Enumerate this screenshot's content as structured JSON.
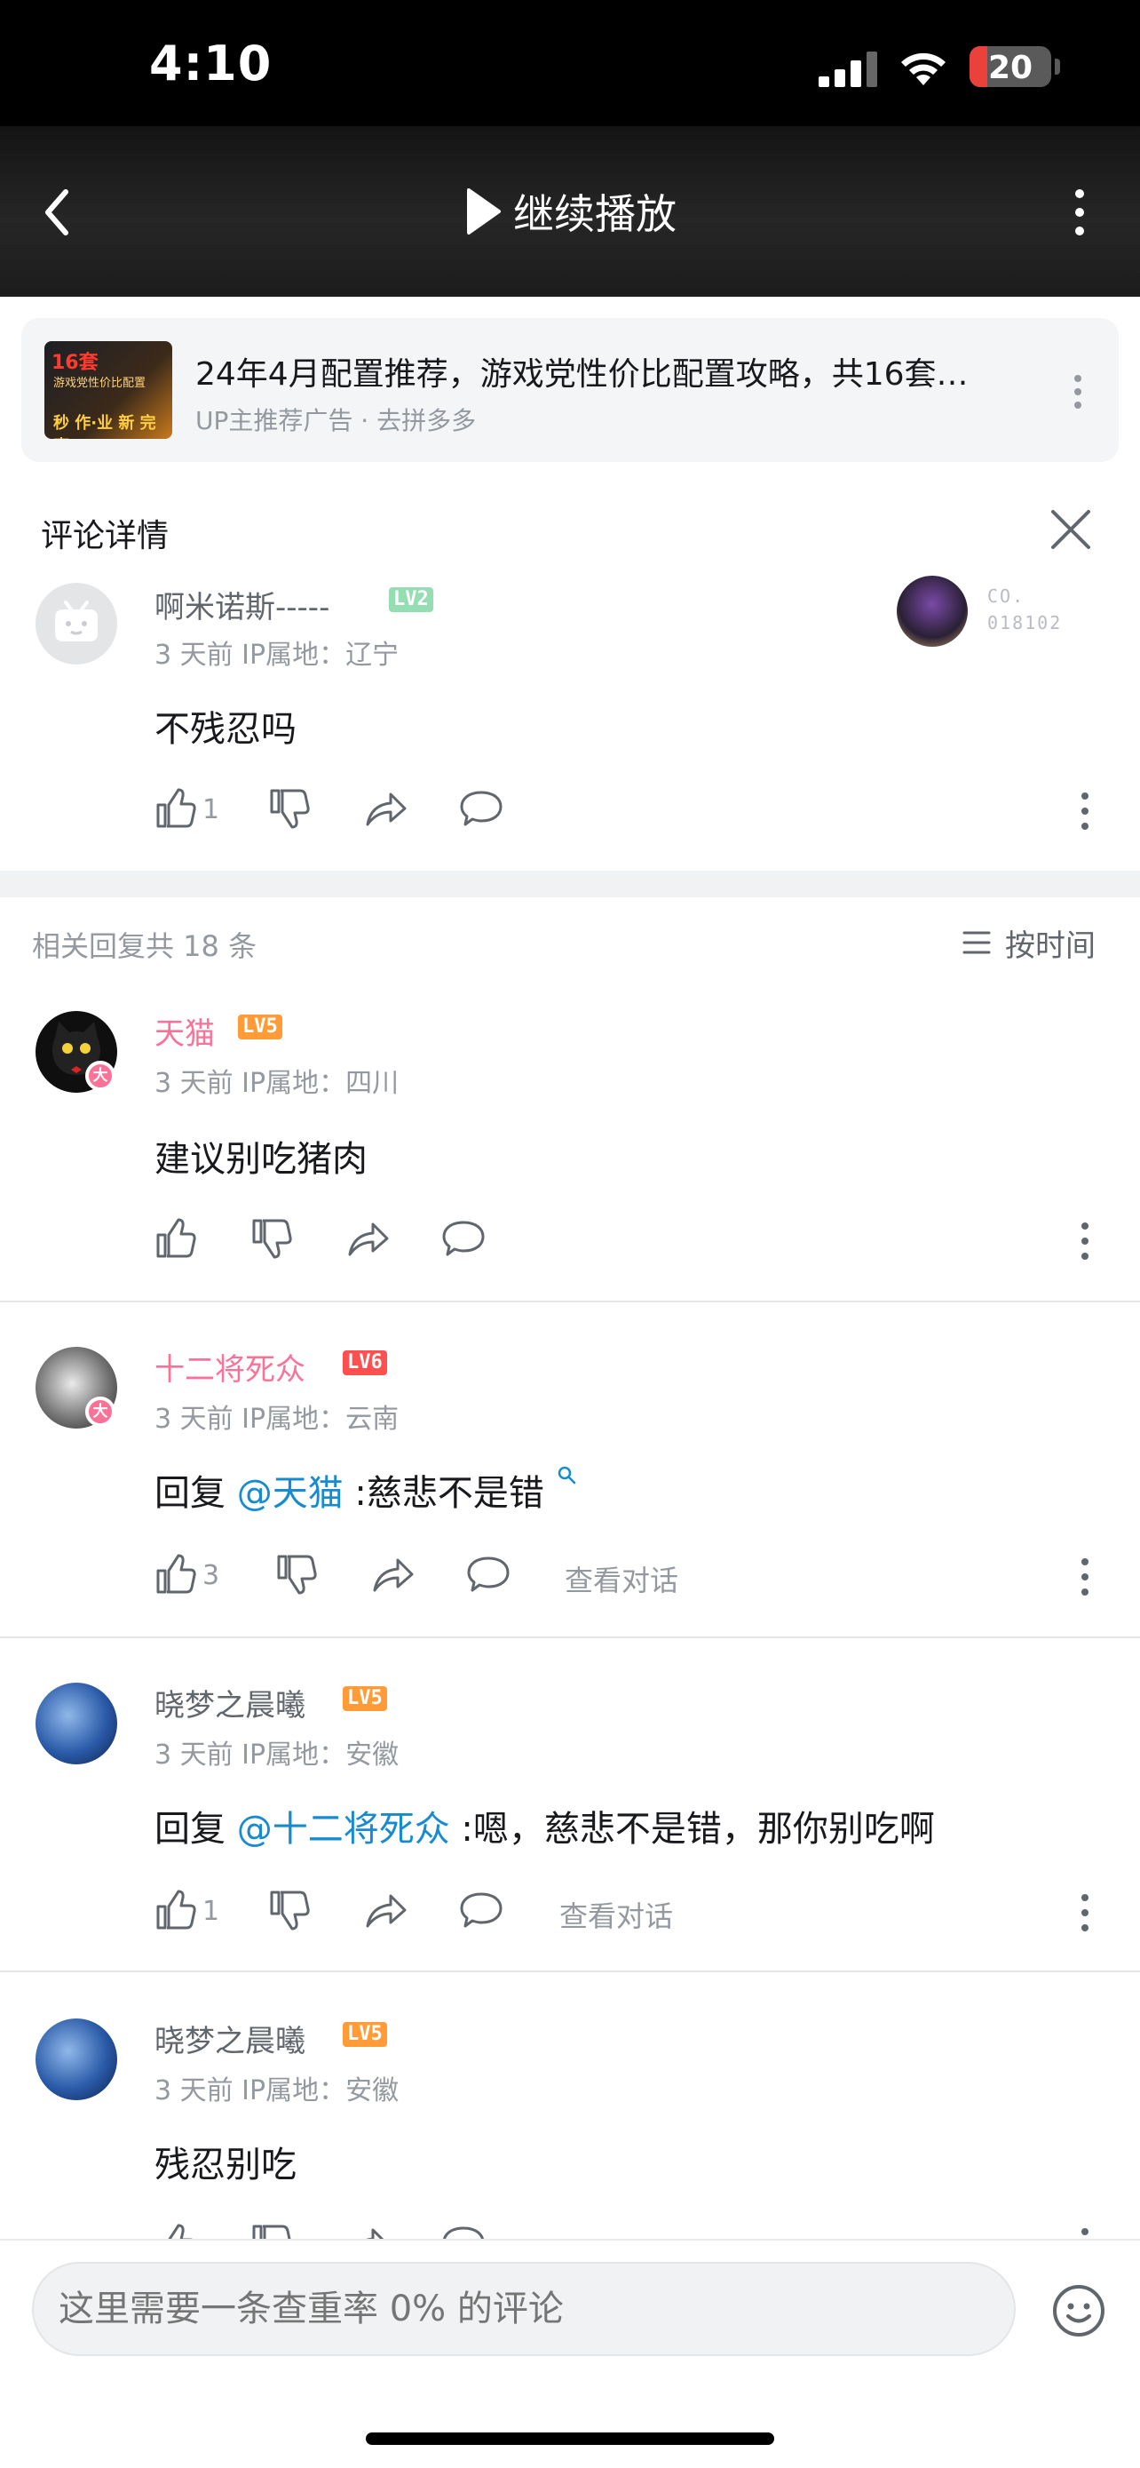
{
  "status_bar": {
    "time": "4:10",
    "battery": "20"
  },
  "video_header": {
    "continue_label": "继续播放"
  },
  "ad": {
    "thumb_badge": "16套",
    "thumb_line1": "游戏党性价比配置",
    "thumb_line2": "秒 作·业 新 完 事",
    "title": "24年4月配置推荐，游戏党性价比配置攻略，共16套…",
    "subtitle": "UP主推荐广告 · 去拼多多"
  },
  "detail": {
    "title": "评论详情",
    "root_comment": {
      "username": "啊米诺斯-----",
      "level": "LV2",
      "meta": "3 天前  IP属地：辽宁",
      "text": "不残忍吗",
      "likes": "1",
      "fan_no_line1": "CO.",
      "fan_no_line2": "018102"
    }
  },
  "replies": {
    "header": "相关回复共 18 条",
    "sort_label": "按时间",
    "view_conversation": "查看对话",
    "items": [
      {
        "username": "天猫",
        "level": "LV5",
        "vip": "大",
        "meta": "3 天前  IP属地：四川",
        "text": "建议别吃猪肉",
        "likes": ""
      },
      {
        "username": "十二将死众",
        "level": "LV6",
        "vip": "大",
        "meta": "3 天前  IP属地：云南",
        "prefix": "回复 ",
        "at": "@天猫",
        "text": " :慈悲不是错",
        "likes": "3"
      },
      {
        "username": "晓梦之晨曦",
        "level": "LV5",
        "meta": "3 天前  IP属地：安徽",
        "prefix": "回复 ",
        "at": "@十二将死众",
        "text": " :嗯，慈悲不是错，那你别吃啊",
        "likes": "1"
      },
      {
        "username": "晓梦之晨曦",
        "level": "LV5",
        "meta": "3 天前  IP属地：安徽",
        "text": "残忍别吃",
        "likes": ""
      }
    ]
  },
  "input": {
    "placeholder": "这里需要一条查重率 0% 的评论"
  },
  "colors": {
    "vip_pink": "#fb7299",
    "link_blue": "#178bcf",
    "lv2_green": "#95ddb2",
    "lv5_orange": "#ff9c38",
    "lv6_red": "#ff4f4f"
  }
}
